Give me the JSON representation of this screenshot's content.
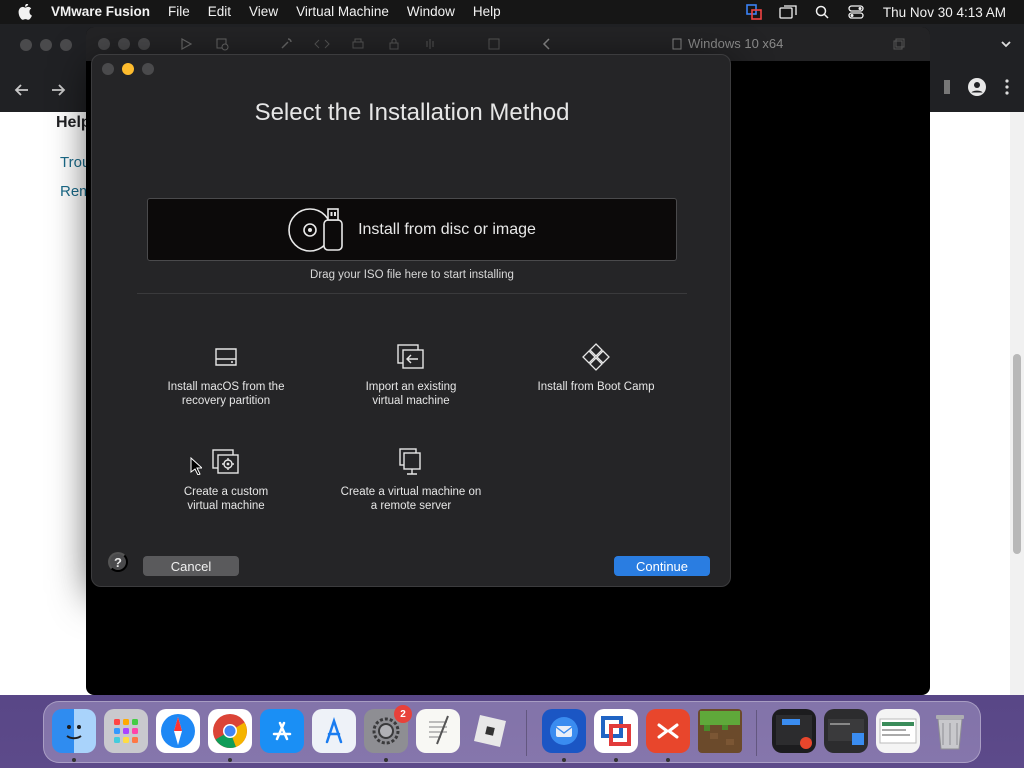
{
  "menubar": {
    "app_name": "VMware Fusion",
    "menus": [
      "File",
      "Edit",
      "View",
      "Virtual Machine",
      "Window",
      "Help"
    ],
    "clock": "Thu Nov 30  4:13 AM"
  },
  "browser": {
    "heading": "Help",
    "links": [
      "Trou",
      "Rem"
    ]
  },
  "vm_window": {
    "title": "Windows 10 x64"
  },
  "dialog": {
    "title": "Select the Installation Method",
    "disc_option": "Install from disc or image",
    "hint": "Drag your ISO file here to start installing",
    "options": [
      {
        "label": "Install macOS from the\nrecovery partition",
        "icon": "hard-drive-icon"
      },
      {
        "label": "Import an existing\nvirtual machine",
        "icon": "import-vm-icon"
      },
      {
        "label": "Install from Boot Camp",
        "icon": "boot-camp-icon"
      },
      {
        "label": "Create a custom\nvirtual machine",
        "icon": "custom-vm-icon"
      },
      {
        "label": "Create a virtual machine on\na remote server",
        "icon": "remote-server-icon"
      }
    ],
    "help_label": "?",
    "cancel_label": "Cancel",
    "continue_label": "Continue"
  },
  "dock": {
    "apps": [
      "Finder",
      "Launchpad",
      "Safari",
      "Chrome",
      "App Store",
      "Xcode Instruments",
      "System Settings",
      "TextEdit",
      "Roblox",
      "Thunderbird",
      "VMware Fusion",
      "Remote Desktop",
      "Minecraft"
    ],
    "settings_badge": "2"
  },
  "colors": {
    "accent": "#2a7de1",
    "dialog_bg": "#252527",
    "traffic_yellow": "#febc2e"
  }
}
